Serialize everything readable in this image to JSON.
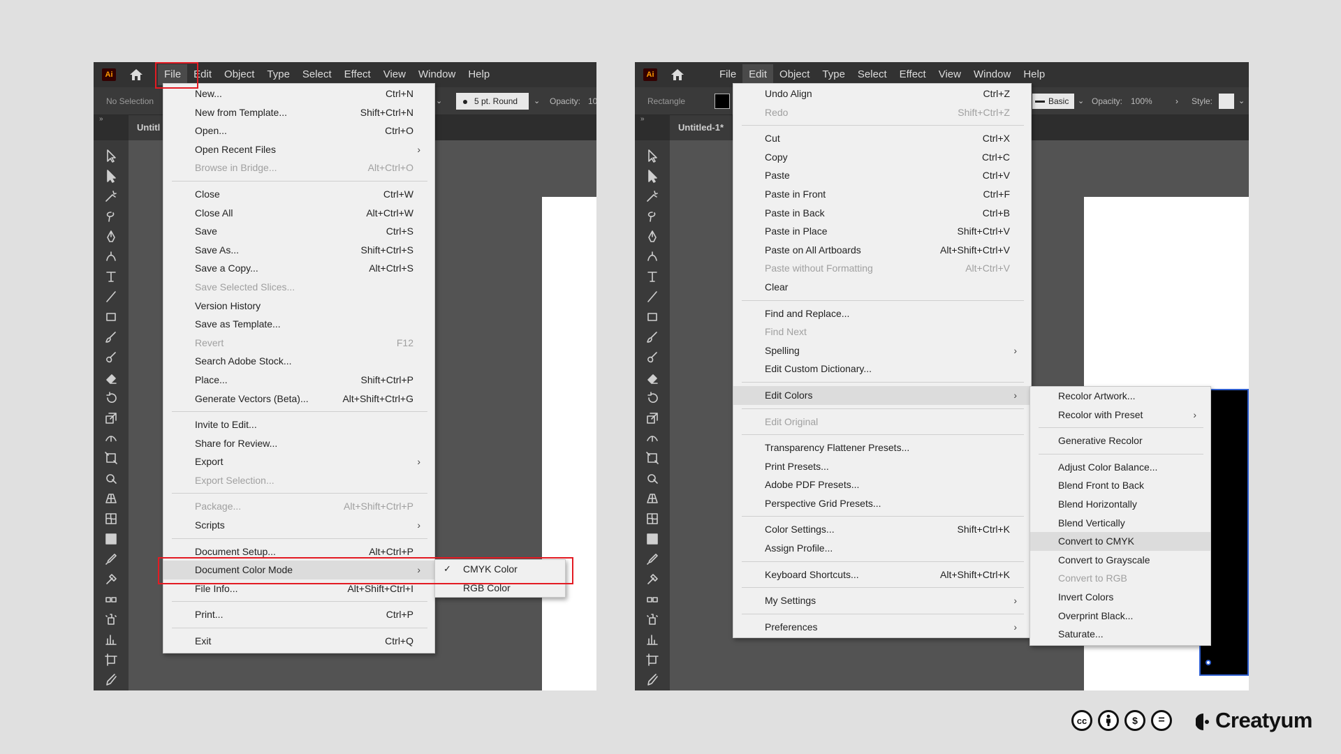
{
  "left": {
    "menubar": [
      "File",
      "Edit",
      "Object",
      "Type",
      "Select",
      "Effect",
      "View",
      "Window",
      "Help"
    ],
    "active_menu": "File",
    "control_label": "No Selection",
    "brush_label": "5 pt. Round",
    "opacity_label": "Opacity:",
    "opacity_value": "10",
    "doc_tab": "Untitl",
    "file_menu": [
      {
        "label": "New...",
        "sc": "Ctrl+N"
      },
      {
        "label": "New from Template...",
        "sc": "Shift+Ctrl+N"
      },
      {
        "label": "Open...",
        "sc": "Ctrl+O"
      },
      {
        "label": "Open Recent Files",
        "sub": true
      },
      {
        "label": "Browse in Bridge...",
        "sc": "Alt+Ctrl+O",
        "disabled": true
      },
      {
        "sep": true
      },
      {
        "label": "Close",
        "sc": "Ctrl+W"
      },
      {
        "label": "Close All",
        "sc": "Alt+Ctrl+W"
      },
      {
        "label": "Save",
        "sc": "Ctrl+S"
      },
      {
        "label": "Save As...",
        "sc": "Shift+Ctrl+S"
      },
      {
        "label": "Save a Copy...",
        "sc": "Alt+Ctrl+S"
      },
      {
        "label": "Save Selected Slices...",
        "disabled": true
      },
      {
        "label": "Version History"
      },
      {
        "label": "Save as Template..."
      },
      {
        "label": "Revert",
        "sc": "F12",
        "disabled": true
      },
      {
        "label": "Search Adobe Stock..."
      },
      {
        "label": "Place...",
        "sc": "Shift+Ctrl+P"
      },
      {
        "label": "Generate Vectors (Beta)...",
        "sc": "Alt+Shift+Ctrl+G"
      },
      {
        "sep": true
      },
      {
        "label": "Invite to Edit..."
      },
      {
        "label": "Share for Review..."
      },
      {
        "label": "Export",
        "sub": true
      },
      {
        "label": "Export Selection...",
        "disabled": true
      },
      {
        "sep": true
      },
      {
        "label": "Package...",
        "sc": "Alt+Shift+Ctrl+P",
        "disabled": true
      },
      {
        "label": "Scripts",
        "sub": true
      },
      {
        "sep": true
      },
      {
        "label": "Document Setup...",
        "sc": "Alt+Ctrl+P"
      },
      {
        "label": "Document Color Mode",
        "sub": true,
        "hl": true
      },
      {
        "label": "File Info...",
        "sc": "Alt+Shift+Ctrl+I"
      },
      {
        "sep": true
      },
      {
        "label": "Print...",
        "sc": "Ctrl+P"
      },
      {
        "sep": true
      },
      {
        "label": "Exit",
        "sc": "Ctrl+Q"
      }
    ],
    "color_mode_menu": [
      {
        "label": "CMYK Color",
        "checked": true
      },
      {
        "label": "RGB Color"
      }
    ]
  },
  "right": {
    "menubar": [
      "File",
      "Edit",
      "Object",
      "Type",
      "Select",
      "Effect",
      "View",
      "Window",
      "Help"
    ],
    "active_menu": "Edit",
    "control_label": "Rectangle",
    "stroke_label": "Basic",
    "opacity_label": "Opacity:",
    "opacity_value": "100%",
    "style_label": "Style:",
    "doc_tab": "Untitled-1*",
    "edit_menu": [
      {
        "label": "Undo Align",
        "sc": "Ctrl+Z"
      },
      {
        "label": "Redo",
        "sc": "Shift+Ctrl+Z",
        "disabled": true
      },
      {
        "sep": true
      },
      {
        "label": "Cut",
        "sc": "Ctrl+X"
      },
      {
        "label": "Copy",
        "sc": "Ctrl+C"
      },
      {
        "label": "Paste",
        "sc": "Ctrl+V"
      },
      {
        "label": "Paste in Front",
        "sc": "Ctrl+F"
      },
      {
        "label": "Paste in Back",
        "sc": "Ctrl+B"
      },
      {
        "label": "Paste in Place",
        "sc": "Shift+Ctrl+V"
      },
      {
        "label": "Paste on All Artboards",
        "sc": "Alt+Shift+Ctrl+V"
      },
      {
        "label": "Paste without Formatting",
        "sc": "Alt+Ctrl+V",
        "disabled": true
      },
      {
        "label": "Clear"
      },
      {
        "sep": true
      },
      {
        "label": "Find and Replace..."
      },
      {
        "label": "Find Next",
        "disabled": true
      },
      {
        "label": "Spelling",
        "sub": true
      },
      {
        "label": "Edit Custom Dictionary..."
      },
      {
        "sep": true
      },
      {
        "label": "Edit Colors",
        "sub": true,
        "hl": true
      },
      {
        "sep": true
      },
      {
        "label": "Edit Original",
        "disabled": true
      },
      {
        "sep": true
      },
      {
        "label": "Transparency Flattener Presets..."
      },
      {
        "label": "Print Presets..."
      },
      {
        "label": "Adobe PDF Presets..."
      },
      {
        "label": "Perspective Grid Presets..."
      },
      {
        "sep": true
      },
      {
        "label": "Color Settings...",
        "sc": "Shift+Ctrl+K"
      },
      {
        "label": "Assign Profile..."
      },
      {
        "sep": true
      },
      {
        "label": "Keyboard Shortcuts...",
        "sc": "Alt+Shift+Ctrl+K"
      },
      {
        "sep": true
      },
      {
        "label": "My Settings",
        "sub": true
      },
      {
        "sep": true
      },
      {
        "label": "Preferences",
        "sub": true
      }
    ],
    "edit_colors_menu": [
      {
        "label": "Recolor Artwork..."
      },
      {
        "label": "Recolor with Preset",
        "sub": true
      },
      {
        "sep": true
      },
      {
        "label": "Generative Recolor"
      },
      {
        "sep": true
      },
      {
        "label": "Adjust Color Balance..."
      },
      {
        "label": "Blend Front to Back"
      },
      {
        "label": "Blend Horizontally"
      },
      {
        "label": "Blend Vertically"
      },
      {
        "label": "Convert to CMYK",
        "hl": true
      },
      {
        "label": "Convert to Grayscale"
      },
      {
        "label": "Convert to RGB",
        "disabled": true
      },
      {
        "label": "Invert Colors"
      },
      {
        "label": "Overprint Black..."
      },
      {
        "label": "Saturate..."
      }
    ]
  },
  "footer": {
    "license_icons": [
      "cc-icon",
      "by-icon",
      "nc-icon",
      "nd-icon"
    ],
    "brand": "Creatyum"
  },
  "colors": {
    "highlight_outline": "#e31b23",
    "app_logo": "#ff9a00"
  }
}
